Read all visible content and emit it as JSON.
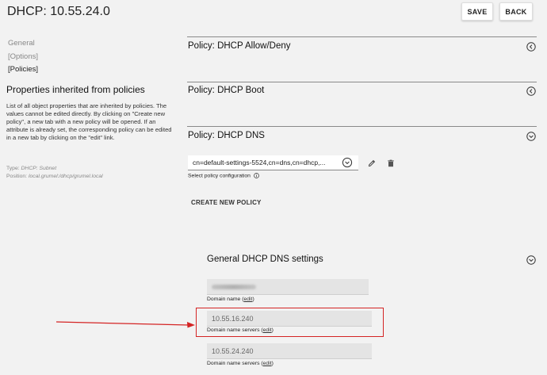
{
  "header": {
    "title": "DHCP: 10.55.24.0",
    "save_label": "SAVE",
    "back_label": "BACK"
  },
  "nav": {
    "general": "General",
    "options": "[Options]",
    "policies": "[Policies]"
  },
  "sidebar": {
    "heading": "Properties inherited from policies",
    "description": "List of all object properties that are inherited by policies. The values cannot be edited directly. By clicking on \"Create new policy\", a new tab with a new policy will be opened. If an attribute is already set, the corresponding policy can be edited in a new tab by clicking on the \"edit\" link.",
    "type_key": "Type:",
    "type_value": "DHCP: Subnet",
    "position_key": "Position:",
    "position_value": "local.grumel:/dhcp/grumel.local"
  },
  "sections": [
    {
      "title": "Policy: DHCP Allow/Deny",
      "state": "collapsed"
    },
    {
      "title": "Policy: DHCP Boot",
      "state": "collapsed"
    },
    {
      "title": "Policy: DHCP DNS",
      "state": "expanded"
    }
  ],
  "dns_policy": {
    "selected_policy": "cn=default-settings-5524,cn=dns,cn=dhcp,...",
    "select_caption": "Select policy configuration",
    "create_label": "CREATE NEW POLICY",
    "settings_title": "General DHCP DNS settings",
    "fields": [
      {
        "value": "",
        "label": "Domain name",
        "link": "edit"
      },
      {
        "value": "10.55.16.240",
        "label": "Domain name servers",
        "link": "edit"
      },
      {
        "value": "10.55.24.240",
        "label": "Domain name servers",
        "link": "edit"
      }
    ]
  },
  "annotation": {
    "highlight_color": "#d42424"
  }
}
